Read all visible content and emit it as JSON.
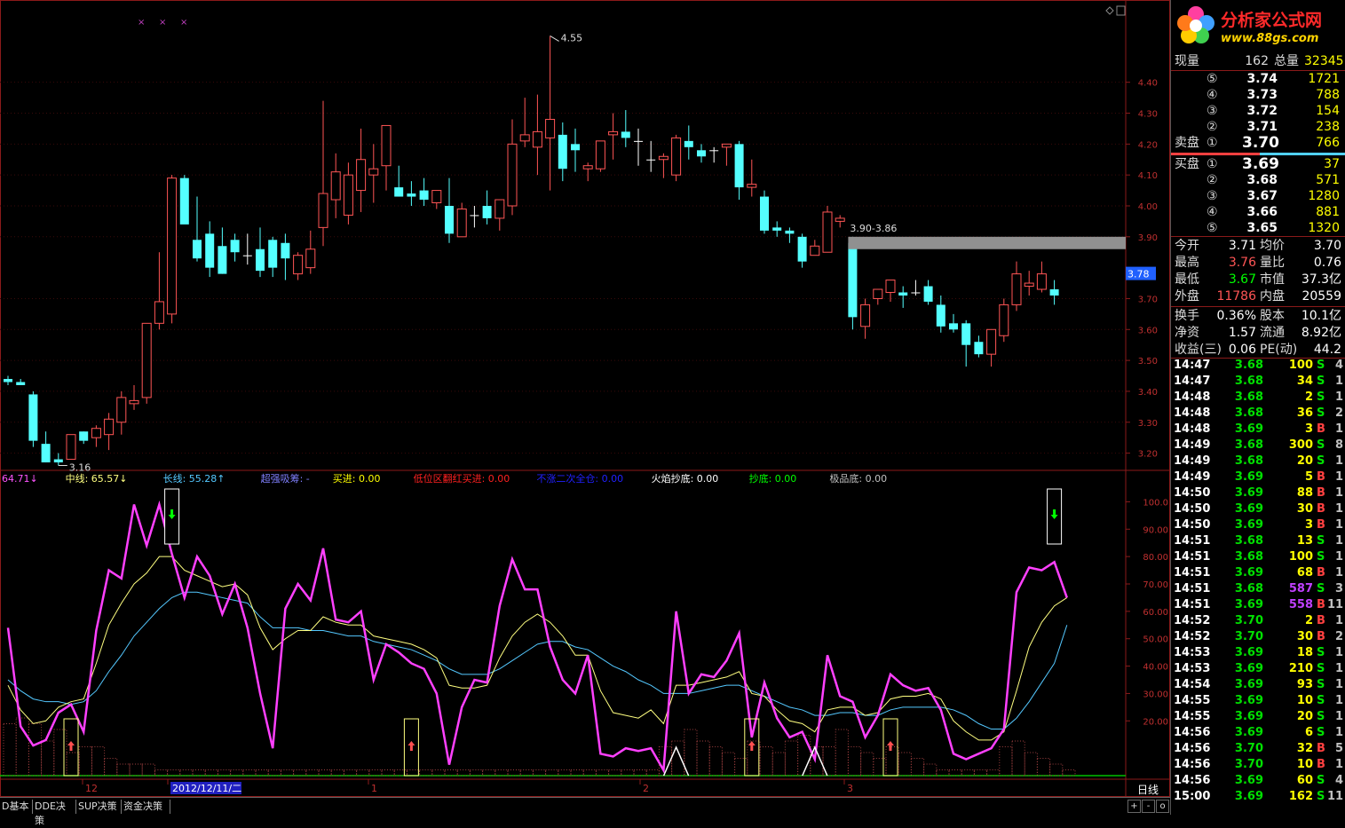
{
  "price_axis": {
    "labels": [
      "4.40",
      "4.30",
      "4.20",
      "4.10",
      "4.00",
      "3.90",
      "3.70",
      "3.60",
      "3.50",
      "3.40",
      "3.30",
      "3.20"
    ],
    "current_price_label": "3.78",
    "price_min": 3.15,
    "price_max": 4.58
  },
  "price_chart": {
    "high_marker": "4.55",
    "low_marker": "3.16",
    "range_label": "3.90-3.86",
    "colors": {
      "up": "#ff5555",
      "down": "#54ffff",
      "flat": "#ffffff"
    },
    "candles": [
      [
        3.44,
        3.45,
        3.42,
        3.43
      ],
      [
        3.43,
        3.44,
        3.42,
        3.42
      ],
      [
        3.39,
        3.4,
        3.22,
        3.24
      ],
      [
        3.23,
        3.27,
        3.17,
        3.17
      ],
      [
        3.18,
        3.2,
        3.16,
        3.17
      ],
      [
        3.18,
        3.26,
        3.18,
        3.26
      ],
      [
        3.27,
        3.27,
        3.23,
        3.24
      ],
      [
        3.25,
        3.29,
        3.22,
        3.28
      ],
      [
        3.26,
        3.33,
        3.21,
        3.31
      ],
      [
        3.3,
        3.4,
        3.26,
        3.38
      ],
      [
        3.36,
        3.42,
        3.34,
        3.37
      ],
      [
        3.38,
        3.62,
        3.36,
        3.62
      ],
      [
        3.62,
        3.85,
        3.6,
        3.69
      ],
      [
        3.65,
        4.1,
        3.62,
        4.09
      ],
      [
        4.09,
        4.1,
        3.95,
        3.94
      ],
      [
        3.89,
        4.03,
        3.82,
        3.83
      ],
      [
        3.91,
        3.95,
        3.77,
        3.8
      ],
      [
        3.87,
        3.93,
        3.78,
        3.78
      ],
      [
        3.89,
        3.91,
        3.82,
        3.85
      ],
      [
        3.84,
        3.91,
        3.81,
        3.84
      ],
      [
        3.86,
        3.93,
        3.77,
        3.79
      ],
      [
        3.89,
        3.9,
        3.77,
        3.8
      ],
      [
        3.88,
        3.91,
        3.76,
        3.83
      ],
      [
        3.78,
        3.85,
        3.76,
        3.84
      ],
      [
        3.8,
        3.92,
        3.78,
        3.86
      ],
      [
        3.93,
        4.34,
        3.87,
        4.04
      ],
      [
        4.02,
        4.17,
        3.96,
        4.11
      ],
      [
        3.97,
        4.14,
        3.94,
        4.1
      ],
      [
        4.05,
        4.25,
        3.98,
        4.15
      ],
      [
        4.1,
        4.2,
        4.01,
        4.12
      ],
      [
        4.13,
        4.26,
        4.05,
        4.26
      ],
      [
        4.06,
        4.13,
        4.03,
        4.03
      ],
      [
        4.04,
        4.08,
        4.0,
        4.03
      ],
      [
        4.05,
        4.09,
        4.0,
        4.02
      ],
      [
        4.01,
        4.05,
        3.99,
        4.05
      ],
      [
        4.0,
        4.09,
        3.88,
        3.91
      ],
      [
        3.9,
        4.01,
        3.9,
        3.99
      ],
      [
        3.97,
        4.0,
        3.93,
        3.97
      ],
      [
        4.0,
        4.05,
        3.94,
        3.96
      ],
      [
        3.96,
        4.02,
        3.92,
        4.02
      ],
      [
        4.0,
        4.28,
        3.97,
        4.2
      ],
      [
        4.21,
        4.35,
        4.19,
        4.23
      ],
      [
        4.19,
        4.36,
        4.1,
        4.24
      ],
      [
        4.22,
        4.55,
        4.05,
        4.28
      ],
      [
        4.23,
        4.27,
        4.08,
        4.12
      ],
      [
        4.2,
        4.25,
        4.11,
        4.18
      ],
      [
        4.12,
        4.14,
        4.08,
        4.13
      ],
      [
        4.12,
        4.2,
        4.11,
        4.21
      ],
      [
        4.23,
        4.3,
        4.15,
        4.24
      ],
      [
        4.24,
        4.31,
        4.19,
        4.22
      ],
      [
        4.21,
        4.25,
        4.13,
        4.21
      ],
      [
        4.15,
        4.21,
        4.11,
        4.15
      ],
      [
        4.15,
        4.17,
        4.09,
        4.16
      ],
      [
        4.1,
        4.23,
        4.08,
        4.22
      ],
      [
        4.21,
        4.26,
        4.15,
        4.19
      ],
      [
        4.18,
        4.2,
        4.14,
        4.16
      ],
      [
        4.18,
        4.19,
        4.14,
        4.18
      ],
      [
        4.19,
        4.2,
        4.13,
        4.2
      ],
      [
        4.2,
        4.21,
        4.02,
        4.06
      ],
      [
        4.06,
        4.15,
        4.03,
        4.07
      ],
      [
        4.03,
        4.05,
        3.91,
        3.92
      ],
      [
        3.93,
        3.95,
        3.9,
        3.92
      ],
      [
        3.92,
        3.93,
        3.88,
        3.91
      ],
      [
        3.9,
        3.91,
        3.8,
        3.82
      ],
      [
        3.84,
        3.89,
        3.84,
        3.87
      ],
      [
        3.85,
        4.0,
        3.85,
        3.98
      ],
      [
        3.95,
        3.97,
        3.93,
        3.96
      ],
      [
        3.88,
        3.9,
        3.6,
        3.64
      ],
      [
        3.61,
        3.7,
        3.57,
        3.68
      ],
      [
        3.7,
        3.73,
        3.68,
        3.73
      ],
      [
        3.72,
        3.76,
        3.69,
        3.76
      ],
      [
        3.72,
        3.74,
        3.67,
        3.71
      ],
      [
        3.72,
        3.76,
        3.71,
        3.72
      ],
      [
        3.74,
        3.76,
        3.68,
        3.69
      ],
      [
        3.68,
        3.71,
        3.59,
        3.61
      ],
      [
        3.62,
        3.65,
        3.59,
        3.6
      ],
      [
        3.62,
        3.63,
        3.48,
        3.55
      ],
      [
        3.56,
        3.58,
        3.51,
        3.52
      ],
      [
        3.52,
        3.6,
        3.48,
        3.6
      ],
      [
        3.58,
        3.7,
        3.56,
        3.68
      ],
      [
        3.68,
        3.82,
        3.66,
        3.78
      ],
      [
        3.74,
        3.79,
        3.71,
        3.75
      ],
      [
        3.73,
        3.82,
        3.72,
        3.78
      ],
      [
        3.73,
        3.76,
        3.68,
        3.71
      ]
    ],
    "top_marks": [
      "×",
      "×",
      "×"
    ]
  },
  "indicator": {
    "legend": [
      {
        "text": "64.71↓",
        "color": "#ff55ff"
      },
      {
        "text": "中线: 65.57↓",
        "color": "#ffff80"
      },
      {
        "text": "长线: 55.28↑",
        "color": "#54c8ff"
      },
      {
        "text": "超强吸筹: -",
        "color": "#8080ff"
      },
      {
        "text": "买进: 0.00",
        "color": "#ffff00"
      },
      {
        "text": "低位区翻红买进: 0.00",
        "color": "#ff2020"
      },
      {
        "text": "不涨二次全仓: 0.00",
        "color": "#2020ff"
      },
      {
        "text": "火焰抄底: 0.00",
        "color": "#ffffff"
      },
      {
        "text": "抄底: 0.00",
        "color": "#00ff00"
      },
      {
        "text": "极品底: 0.00",
        "color": "#c0c0c0"
      }
    ],
    "axis_labels": [
      "100.0",
      "90.00",
      "80.00",
      "70.00",
      "60.00",
      "50.00",
      "40.00",
      "30.00",
      "20.00"
    ],
    "short": [
      54,
      18,
      11,
      13,
      23,
      26,
      16,
      53,
      75,
      72,
      99,
      84,
      99,
      81,
      65,
      80,
      73,
      59,
      70,
      54,
      30,
      10,
      61,
      70,
      64,
      83,
      57,
      56,
      60,
      35,
      48,
      45,
      41,
      39,
      30,
      4,
      25,
      35,
      34,
      62,
      79,
      68,
      68,
      47,
      35,
      30,
      44,
      8,
      7,
      10,
      9,
      10,
      2,
      60,
      30,
      37,
      36,
      42,
      52,
      14,
      34,
      21,
      14,
      16,
      6,
      44,
      29,
      27,
      14,
      22,
      37,
      33,
      31,
      32,
      24,
      8,
      6,
      8,
      10,
      17,
      67,
      76,
      75,
      78,
      65
    ],
    "mid": [
      33,
      24,
      19,
      20,
      25,
      27,
      28,
      41,
      55,
      63,
      70,
      74,
      80,
      80,
      75,
      73,
      71,
      69,
      70,
      66,
      54,
      46,
      50,
      53,
      53,
      58,
      56,
      55,
      55,
      51,
      50,
      49,
      48,
      46,
      43,
      33,
      32,
      32,
      33,
      43,
      51,
      56,
      59,
      56,
      51,
      44,
      44,
      31,
      23,
      22,
      21,
      24,
      19,
      33,
      33,
      34,
      35,
      36,
      38,
      30,
      29,
      24,
      20,
      19,
      16,
      24,
      25,
      25,
      22,
      23,
      28,
      29,
      29,
      30,
      28,
      20,
      16,
      13,
      13,
      16,
      31,
      47,
      56,
      62,
      65
    ],
    "long": [
      35,
      31,
      28,
      27,
      27,
      26,
      27,
      31,
      38,
      44,
      51,
      56,
      61,
      65,
      67,
      67,
      66,
      65,
      64,
      63,
      58,
      54,
      54,
      54,
      53,
      53,
      52,
      51,
      51,
      49,
      48,
      47,
      46,
      44,
      42,
      39,
      37,
      37,
      37,
      39,
      42,
      45,
      48,
      49,
      49,
      47,
      46,
      43,
      40,
      38,
      35,
      33,
      30,
      30,
      30,
      31,
      32,
      33,
      33,
      31,
      29,
      27,
      25,
      24,
      22,
      22,
      23,
      23,
      22,
      22,
      24,
      25,
      25,
      25,
      25,
      24,
      22,
      19,
      17,
      17,
      21,
      27,
      34,
      41,
      55
    ],
    "signal_down": [
      13,
      83
    ],
    "signal_up": [
      5,
      32,
      59,
      70
    ],
    "bars": [
      9,
      10,
      9,
      6,
      8,
      4,
      5,
      5,
      3,
      2,
      2,
      2,
      1,
      1,
      1,
      1,
      1,
      1,
      1,
      1,
      1,
      1,
      1,
      1,
      1,
      1,
      1,
      1,
      1,
      1,
      1,
      1,
      1,
      1,
      1,
      1,
      1,
      1,
      1,
      1,
      1,
      1,
      1,
      1,
      1,
      1,
      1,
      1,
      1,
      1,
      1,
      1,
      5,
      6,
      8,
      6,
      5,
      4,
      3,
      6,
      5,
      4,
      6,
      7,
      5,
      5,
      8,
      5,
      4,
      3,
      5,
      4,
      3,
      2,
      1,
      1,
      1,
      1,
      1,
      5,
      6,
      4,
      3,
      2,
      1
    ],
    "date_labels": [
      "12",
      "2012/12/11/二",
      "1",
      "2",
      "3"
    ],
    "period_label": "日线"
  },
  "bottom_tabs": [
    "D基本",
    "DDE决策",
    "SUP决策",
    "资金决策"
  ],
  "scroll_buttons": [
    "+",
    "-",
    "o"
  ],
  "quote": {
    "logo_title": "分析家公式网",
    "logo_url": "www.88gs.com",
    "now_label": "现量",
    "now_value": "162",
    "total_label": "总量",
    "total_value": "32345",
    "sell_label": "卖盘",
    "buy_label": "买盘",
    "sells": [
      {
        "idx": "⑤",
        "price": "3.74",
        "vol": "1721"
      },
      {
        "idx": "④",
        "price": "3.73",
        "vol": "788"
      },
      {
        "idx": "③",
        "price": "3.72",
        "vol": "154"
      },
      {
        "idx": "②",
        "price": "3.71",
        "vol": "238"
      },
      {
        "idx": "①",
        "price": "3.70",
        "vol": "766"
      }
    ],
    "buys": [
      {
        "idx": "①",
        "price": "3.69",
        "vol": "37"
      },
      {
        "idx": "②",
        "price": "3.68",
        "vol": "571"
      },
      {
        "idx": "③",
        "price": "3.67",
        "vol": "1280"
      },
      {
        "idx": "④",
        "price": "3.66",
        "vol": "881"
      },
      {
        "idx": "⑤",
        "price": "3.65",
        "vol": "1320"
      }
    ],
    "stats": [
      {
        "l1": "今开",
        "v1": "3.71",
        "l2": "均价",
        "v2": "3.70",
        "c1": "#ffffff"
      },
      {
        "l1": "最高",
        "v1": "3.76",
        "l2": "量比",
        "v2": "0.76",
        "c1": "#ff5555"
      },
      {
        "l1": "最低",
        "v1": "3.67",
        "l2": "市值",
        "v2": "37.3亿",
        "c1": "#00ff00"
      },
      {
        "l1": "外盘",
        "v1": "11786",
        "l2": "内盘",
        "v2": "20559",
        "c1": "#ff5555"
      }
    ],
    "stats2": [
      {
        "l1": "换手",
        "v1": "0.36%",
        "l2": "股本",
        "v2": "10.1亿"
      },
      {
        "l1": "净资",
        "v1": "1.57",
        "l2": "流通",
        "v2": "8.92亿"
      },
      {
        "l1": "收益(三)",
        "v1": "0.06",
        "l2": "PE(动)",
        "v2": "44.2"
      }
    ],
    "ticks": [
      {
        "t": "14:47",
        "p": "3.68",
        "v": "100",
        "s": "S",
        "n": "4"
      },
      {
        "t": "14:47",
        "p": "3.68",
        "v": "34",
        "s": "S",
        "n": "1"
      },
      {
        "t": "14:48",
        "p": "3.68",
        "v": "2",
        "s": "S",
        "n": "1"
      },
      {
        "t": "14:48",
        "p": "3.68",
        "v": "36",
        "s": "S",
        "n": "2"
      },
      {
        "t": "14:48",
        "p": "3.69",
        "v": "3",
        "s": "B",
        "n": "1"
      },
      {
        "t": "14:49",
        "p": "3.68",
        "v": "300",
        "s": "S",
        "n": "8"
      },
      {
        "t": "14:49",
        "p": "3.68",
        "v": "20",
        "s": "S",
        "n": "1"
      },
      {
        "t": "14:49",
        "p": "3.69",
        "v": "5",
        "s": "B",
        "n": "1"
      },
      {
        "t": "14:50",
        "p": "3.69",
        "v": "88",
        "s": "B",
        "n": "1"
      },
      {
        "t": "14:50",
        "p": "3.69",
        "v": "30",
        "s": "B",
        "n": "1"
      },
      {
        "t": "14:50",
        "p": "3.69",
        "v": "3",
        "s": "B",
        "n": "1"
      },
      {
        "t": "14:51",
        "p": "3.68",
        "v": "13",
        "s": "S",
        "n": "1"
      },
      {
        "t": "14:51",
        "p": "3.68",
        "v": "100",
        "s": "S",
        "n": "1"
      },
      {
        "t": "14:51",
        "p": "3.69",
        "v": "68",
        "s": "B",
        "n": "1"
      },
      {
        "t": "14:51",
        "p": "3.68",
        "v": "587",
        "s": "S",
        "n": "3"
      },
      {
        "t": "14:51",
        "p": "3.69",
        "v": "558",
        "s": "B",
        "n": "11"
      },
      {
        "t": "14:52",
        "p": "3.70",
        "v": "2",
        "s": "B",
        "n": "1"
      },
      {
        "t": "14:52",
        "p": "3.70",
        "v": "30",
        "s": "B",
        "n": "2"
      },
      {
        "t": "14:53",
        "p": "3.69",
        "v": "18",
        "s": "S",
        "n": "1"
      },
      {
        "t": "14:53",
        "p": "3.69",
        "v": "210",
        "s": "S",
        "n": "1"
      },
      {
        "t": "14:54",
        "p": "3.69",
        "v": "93",
        "s": "S",
        "n": "1"
      },
      {
        "t": "14:55",
        "p": "3.69",
        "v": "10",
        "s": "S",
        "n": "1"
      },
      {
        "t": "14:55",
        "p": "3.69",
        "v": "20",
        "s": "S",
        "n": "1"
      },
      {
        "t": "14:56",
        "p": "3.69",
        "v": "6",
        "s": "S",
        "n": "1"
      },
      {
        "t": "14:56",
        "p": "3.70",
        "v": "32",
        "s": "B",
        "n": "5"
      },
      {
        "t": "14:56",
        "p": "3.70",
        "v": "10",
        "s": "B",
        "n": "1"
      },
      {
        "t": "14:56",
        "p": "3.69",
        "v": "60",
        "s": "S",
        "n": "4"
      },
      {
        "t": "15:00",
        "p": "3.69",
        "v": "162",
        "s": "S",
        "n": "11"
      }
    ]
  }
}
